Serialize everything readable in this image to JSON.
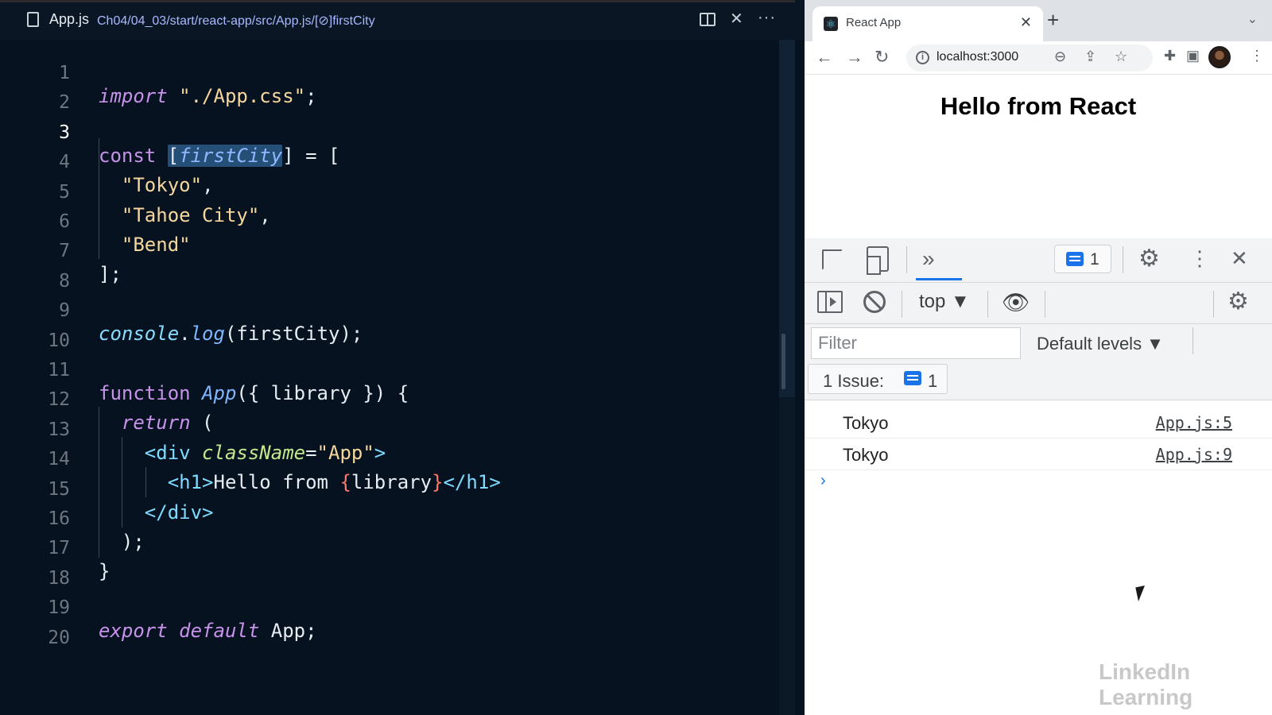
{
  "editor": {
    "file_name": "App.js",
    "breadcrumb_path": "Ch04/04_03/start/react-app/src/App.js",
    "breadcrumb_symbol": "firstCity",
    "line_numbers": [
      "1",
      "2",
      "3",
      "4",
      "5",
      "6",
      "7",
      "8",
      "9",
      "10",
      "11",
      "12",
      "13",
      "14",
      "15",
      "16",
      "17",
      "18",
      "19",
      "20"
    ],
    "code": {
      "l1_import": "import",
      "l1_str": "\"./App.css\"",
      "l1_end": ";",
      "l3_const": "const",
      "l3_open": "[",
      "l3_var": "firstCity",
      "l3_rest": "] = [",
      "l4_str": "\"Tokyo\"",
      "l4_end": ",",
      "l5_str": "\"Tahoe City\"",
      "l5_end": ",",
      "l6_str": "\"Bend\"",
      "l7": "];",
      "l9_obj": "console",
      "l9_dot": ".",
      "l9_fn": "log",
      "l9_rest": "(firstCity);",
      "l11_kw": "function",
      "l11_fn": "App",
      "l11_rest": "({ library }) {",
      "l12_kw": "return",
      "l12_rest": " (",
      "l13_open": "<div",
      "l13_attr": "className",
      "l13_eq": "=",
      "l13_str": "\"App\"",
      "l13_close": ">",
      "l14_open": "<h1>",
      "l14_text": "Hello from ",
      "l14_b1": "{",
      "l14_var": "library",
      "l14_b2": "}",
      "l14_close": "</h1>",
      "l15": "</div>",
      "l16": ");",
      "l17": "}",
      "l19_kw1": "export",
      "l19_kw2": "default",
      "l19_rest": "App;"
    }
  },
  "browser": {
    "tab_title": "React App",
    "url": "localhost:3000",
    "page_heading": "Hello from React"
  },
  "devtools": {
    "issues_count": "1",
    "context": "top ▼",
    "filter_placeholder": "Filter",
    "levels": "Default levels ▼",
    "issue_label": "1 Issue:",
    "issue_count": "1",
    "logs": [
      {
        "message": "Tokyo",
        "source": "App.js:5"
      },
      {
        "message": "Tokyo",
        "source": "App.js:9"
      }
    ],
    "prompt": "›"
  },
  "watermark": "LinkedIn Learning",
  "colors": {
    "editor_bg": "#06121f",
    "keyword": "#c792ea",
    "string": "#f5d79e",
    "function": "#7fb7ff",
    "accent": "#1a73e8"
  }
}
